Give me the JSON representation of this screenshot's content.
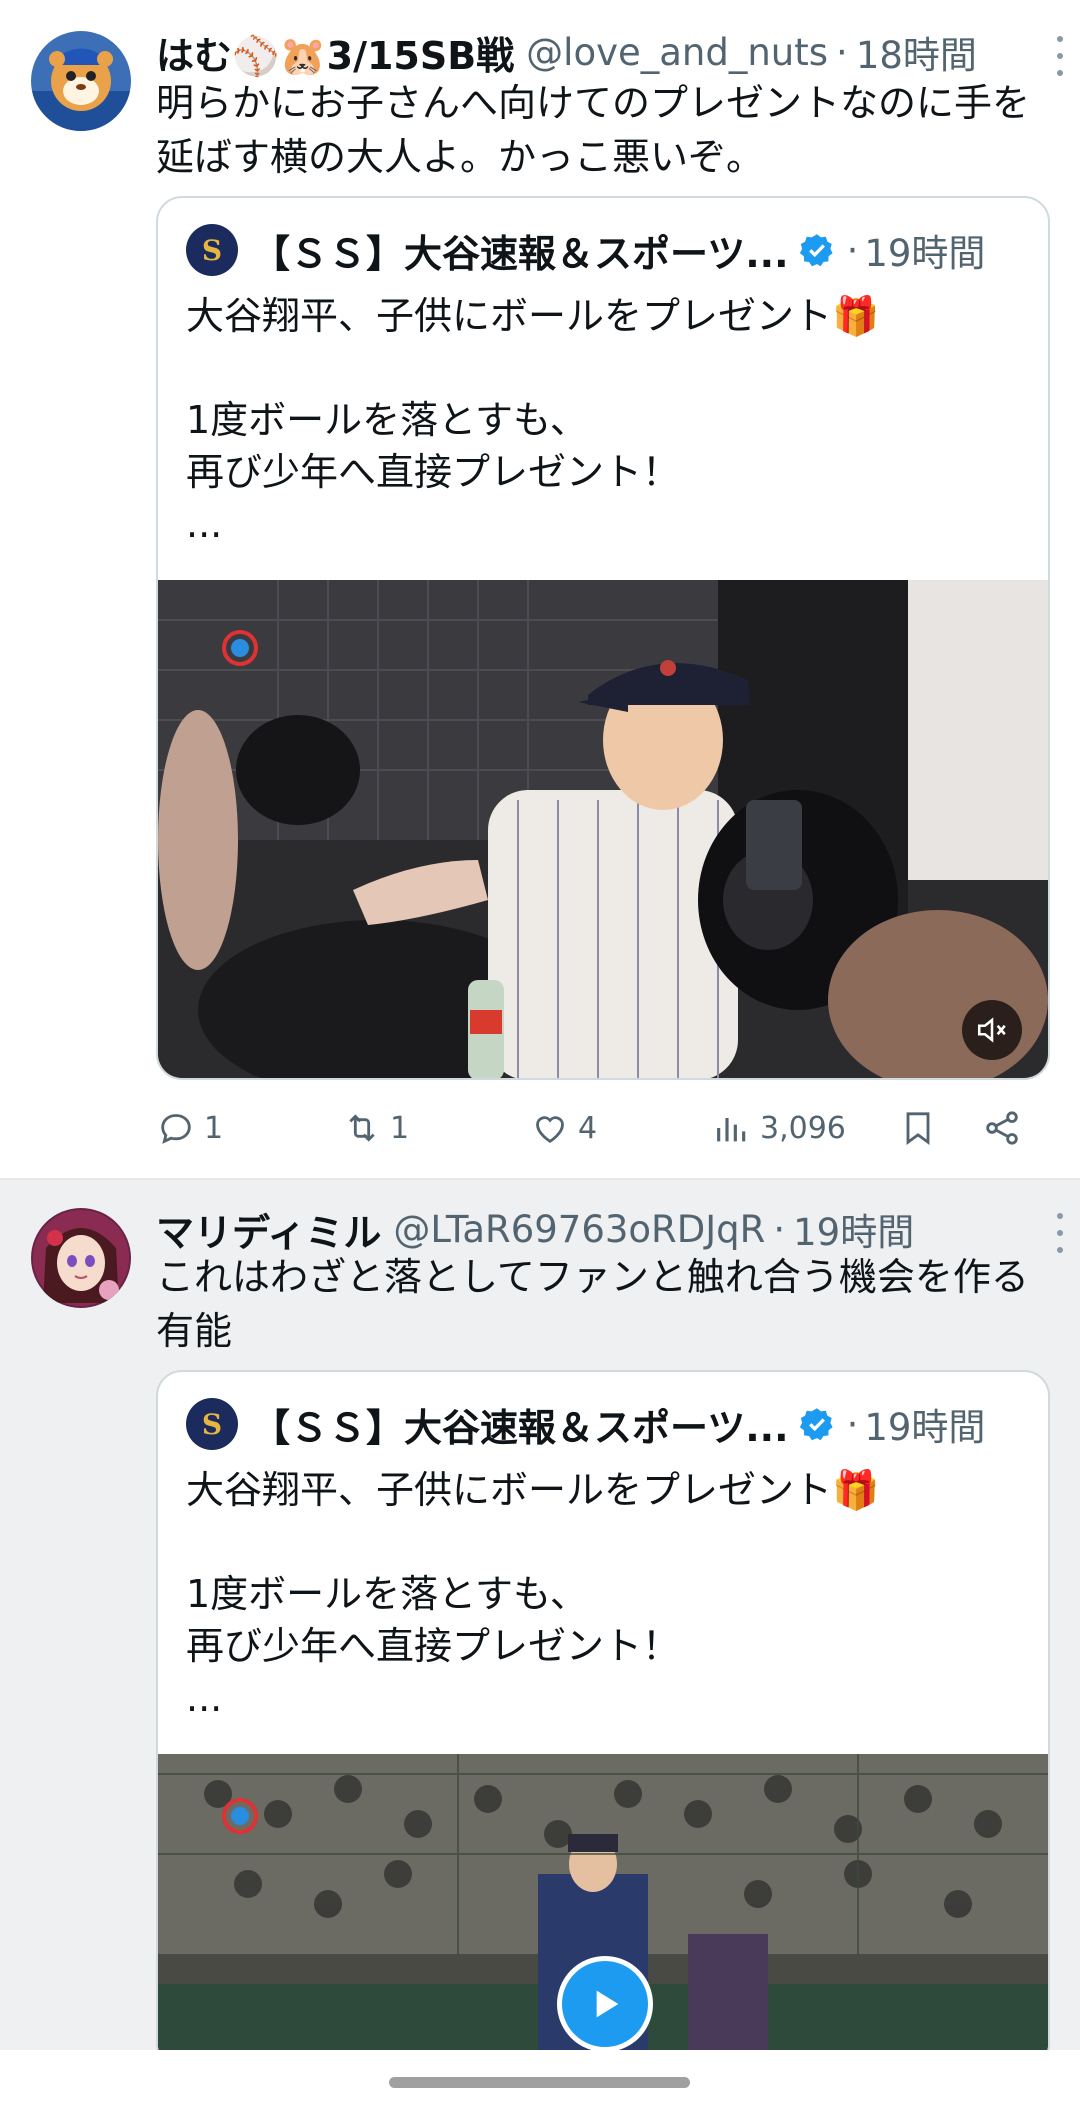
{
  "tweets": [
    {
      "display_name": "はむ⚾🐹3/15SB戦",
      "handle": "@love_and_nuts",
      "time": "18時間",
      "text": "明らかにお子さんへ向けてのプレゼントなのに手を延ばす横の大人よ。かっこ悪いぞ。",
      "quote": {
        "name": "【ＳＳ】大谷速報＆スポーツ...",
        "time": "19時間",
        "text": "大谷翔平、子供にボールをプレゼント🎁\n\n1度ボールを落とすも、\n再び少年へ直接プレゼント！\n..."
      },
      "actions": {
        "replies": "1",
        "retweets": "1",
        "likes": "4",
        "views": "3,096"
      }
    },
    {
      "display_name": "マリディミル",
      "handle": "@LTaR69763oRDJqR",
      "time": "19時間",
      "text": "これはわざと落としてファンと触れ合う機会を作る有能",
      "quote": {
        "name": "【ＳＳ】大谷速報＆スポーツ...",
        "time": "19時間",
        "text": "大谷翔平、子供にボールをプレゼント🎁\n\n1度ボールを落とすも、\n再び少年へ直接プレゼント！\n..."
      }
    }
  ],
  "icons": {
    "more": "more-dots-icon",
    "verified": "verified-badge-icon",
    "reply": "reply-icon",
    "retweet": "retweet-icon",
    "like": "heart-icon",
    "views": "views-chart-icon",
    "bookmark": "bookmark-icon",
    "share": "share-icon",
    "mute": "muted-speaker-icon",
    "play": "play-icon"
  },
  "colors": {
    "verified": "#1d9bf0",
    "secondary_text": "#536471",
    "play_button": "#1d9bf0",
    "second_tweet_bg": "#eef0f2"
  }
}
